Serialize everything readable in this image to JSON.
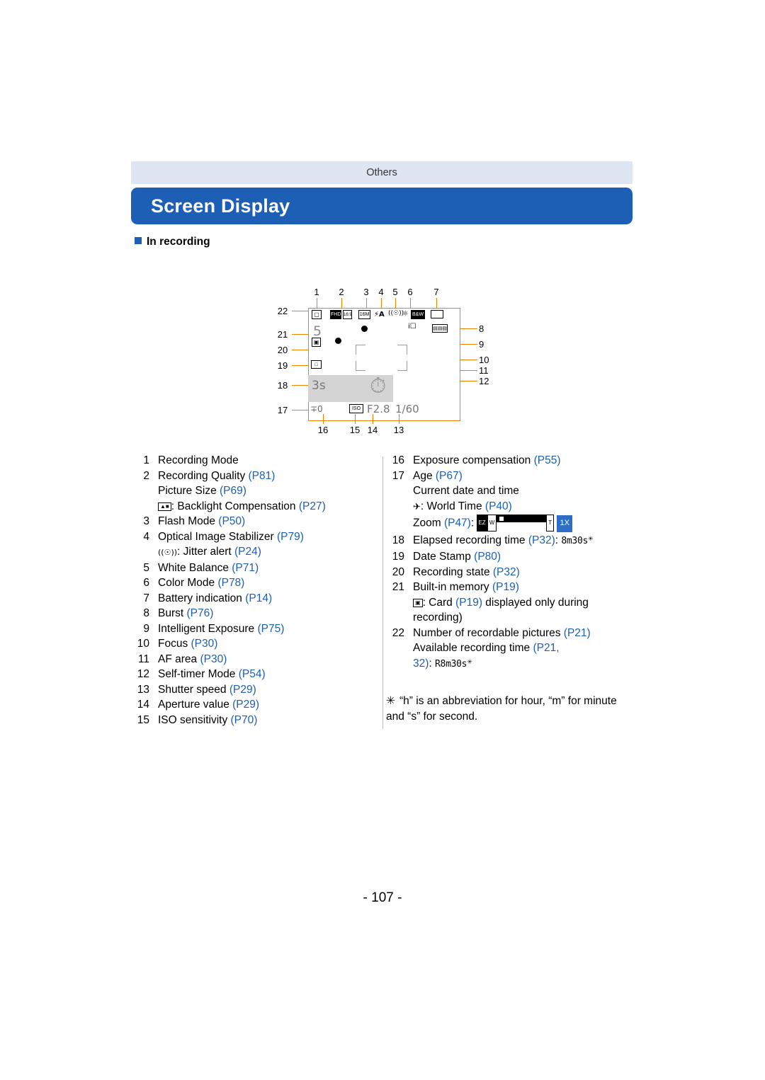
{
  "header": {
    "band_text": "Others",
    "title": "Screen Display",
    "subhead": "In recording",
    "page_number": "- 107 -"
  },
  "diagram": {
    "top_numbers": [
      "1",
      "2",
      "3",
      "4",
      "5",
      "6",
      "7"
    ],
    "left_numbers": [
      "22",
      "21",
      "20",
      "19",
      "18",
      "17"
    ],
    "right_numbers": [
      "8",
      "9",
      "10",
      "11",
      "12"
    ],
    "bottom_numbers": [
      "16",
      "15",
      "14",
      "13"
    ],
    "lcd_icons": {
      "rec_mode": "camera",
      "quality_1": "FHD",
      "quality_2": "16:9",
      "picture_size": "16M",
      "flash": "4A",
      "ois": "OIS",
      "white_balance": "AWB",
      "color_mode": "B&W",
      "battery": "battery-full",
      "burst": "burst",
      "intelligent_exposure": "iA",
      "self_timer": "10s",
      "elapsed": "3s",
      "exposure_comp": "+/-",
      "iso": "ISO",
      "aperture": "F2.8",
      "shutter": "1/60",
      "recordable_pictures": "5"
    }
  },
  "legend": {
    "left": [
      {
        "n": "1",
        "text": "Recording Mode",
        "ref": ""
      },
      {
        "n": "2",
        "text": "Recording Quality ",
        "ref": "(P81)"
      },
      {
        "n": "",
        "text": "Picture Size ",
        "ref": "(P69)"
      },
      {
        "n": "",
        "icon": "backlight-icon",
        "text": ": Backlight Compensation ",
        "ref": "(P27)"
      },
      {
        "n": "3",
        "text": "Flash Mode ",
        "ref": "(P50)"
      },
      {
        "n": "4",
        "text": "Optical Image Stabilizer ",
        "ref": "(P79)"
      },
      {
        "n": "",
        "icon": "jitter-icon",
        "text": ": Jitter alert ",
        "ref": "(P24)"
      },
      {
        "n": "5",
        "text": "White Balance ",
        "ref": "(P71)"
      },
      {
        "n": "6",
        "text": "Color Mode ",
        "ref": "(P78)"
      },
      {
        "n": "7",
        "text": "Battery indication ",
        "ref": "(P14)"
      },
      {
        "n": "8",
        "text": "Burst ",
        "ref": "(P76)"
      },
      {
        "n": "9",
        "text": "Intelligent Exposure ",
        "ref": "(P75)"
      },
      {
        "n": "10",
        "text": "Focus ",
        "ref": "(P30)"
      },
      {
        "n": "11",
        "text": "AF area ",
        "ref": "(P30)"
      },
      {
        "n": "12",
        "text": "Self-timer Mode ",
        "ref": "(P54)"
      },
      {
        "n": "13",
        "text": "Shutter speed ",
        "ref": "(P29)"
      },
      {
        "n": "14",
        "text": "Aperture value ",
        "ref": "(P29)"
      },
      {
        "n": "15",
        "text": "ISO sensitivity ",
        "ref": "(P70)"
      }
    ],
    "right": [
      {
        "n": "16",
        "text": "Exposure compensation ",
        "ref": "(P55)"
      },
      {
        "n": "17",
        "text": "Age ",
        "ref": "(P67)"
      },
      {
        "n": "",
        "text": "Current date and time",
        "ref": ""
      },
      {
        "n": "",
        "icon": "world-time-icon",
        "text": ": World Time ",
        "ref": "(P40)"
      },
      {
        "n": "",
        "text": "Zoom ",
        "ref": "(P47)",
        "suffix": ":",
        "zoom_bar": true,
        "zoom_value": "1X"
      },
      {
        "n": "18",
        "text": "Elapsed recording time ",
        "ref": "(P32)",
        "suffix": ":",
        "lcd": "8m30s",
        "star": true
      },
      {
        "n": "19",
        "text": "Date Stamp ",
        "ref": "(P80)"
      },
      {
        "n": "20",
        "text": "Recording state ",
        "ref": "(P32)"
      },
      {
        "n": "21",
        "text": "Built-in memory ",
        "ref": "(P19)"
      },
      {
        "n": "",
        "icon": "card-icon",
        "text": ": Card ",
        "ref": "(P19)",
        "tail": " displayed only during"
      },
      {
        "n": "",
        "text": "recording)",
        "ref": ""
      },
      {
        "n": "22",
        "text": "Number of recordable pictures ",
        "ref": "(P21)"
      },
      {
        "n": "",
        "text": "Available recording time ",
        "ref": "(P21,"
      },
      {
        "n": "",
        "text": "32)",
        "ref": "",
        "suffix": ":",
        "lcd": "R8m30s",
        "star": true
      }
    ],
    "note": "“h” is an abbreviation for hour, “m” for minute and “s” for second.",
    "note_star": "✳"
  },
  "colors": {
    "accent": "#1d5fb5",
    "band": "#dfe6f3",
    "callout": "#f08000",
    "lcd_gray": "#d4d4d4"
  }
}
